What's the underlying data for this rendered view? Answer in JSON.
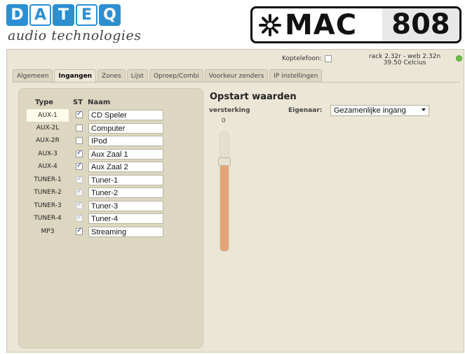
{
  "brand": {
    "logo_letters": [
      "D",
      "A",
      "T",
      "E",
      "Q"
    ],
    "tagline": "audio technologies",
    "product_name": "MAC",
    "product_number": "808",
    "product_icon": "asterisk-snowflake-icon"
  },
  "status": {
    "koptelefoon_label": "Koptelefoon:",
    "koptelefoon_checked": false,
    "version_line1": "rack 2.32r - web 2.32n",
    "version_line2": "39.50 Celcius",
    "led_color": "#6cc04a"
  },
  "tabs": [
    {
      "label": "Algemeen",
      "active": false
    },
    {
      "label": "Ingangen",
      "active": true
    },
    {
      "label": "Zones",
      "active": false
    },
    {
      "label": "Lijst",
      "active": false
    },
    {
      "label": "Oproep/Combi",
      "active": false
    },
    {
      "label": "Voorkeur zenders",
      "active": false
    },
    {
      "label": "IP instellingen",
      "active": false
    }
  ],
  "inputs": {
    "headers": {
      "type": "Type",
      "st": "ST",
      "name": "Naam"
    },
    "rows": [
      {
        "type": "AUX-1",
        "st": true,
        "st_disabled": false,
        "name": "CD Speler"
      },
      {
        "type": "AUX-2L",
        "st": false,
        "st_disabled": false,
        "name": "Computer"
      },
      {
        "type": "AUX-2R",
        "st": false,
        "st_disabled": false,
        "name": "IPod"
      },
      {
        "type": "AUX-3",
        "st": true,
        "st_disabled": false,
        "name": "Aux Zaal 1"
      },
      {
        "type": "AUX-4",
        "st": true,
        "st_disabled": false,
        "name": "Aux Zaal 2"
      },
      {
        "type": "TUNER-1",
        "st": true,
        "st_disabled": true,
        "name": "Tuner-1"
      },
      {
        "type": "TUNER-2",
        "st": true,
        "st_disabled": true,
        "name": "Tuner-2"
      },
      {
        "type": "TUNER-3",
        "st": true,
        "st_disabled": true,
        "name": "Tuner-3"
      },
      {
        "type": "TUNER-4",
        "st": true,
        "st_disabled": true,
        "name": "Tuner-4"
      },
      {
        "type": "MP3",
        "st": true,
        "st_disabled": false,
        "name": "Streaming"
      }
    ]
  },
  "opstart": {
    "title": "Opstart waarden",
    "versterking_label": "versterking",
    "versterking_value": "0",
    "versterking_level": 0.75,
    "eigenaar_label": "Eigenaar:",
    "eigenaar_value": "Gezamenlijke ingang"
  },
  "colors": {
    "brand_blue": "#2b8fd2",
    "panel_bg": "#ebe6d6",
    "slider_fill": "#e3a47a"
  }
}
